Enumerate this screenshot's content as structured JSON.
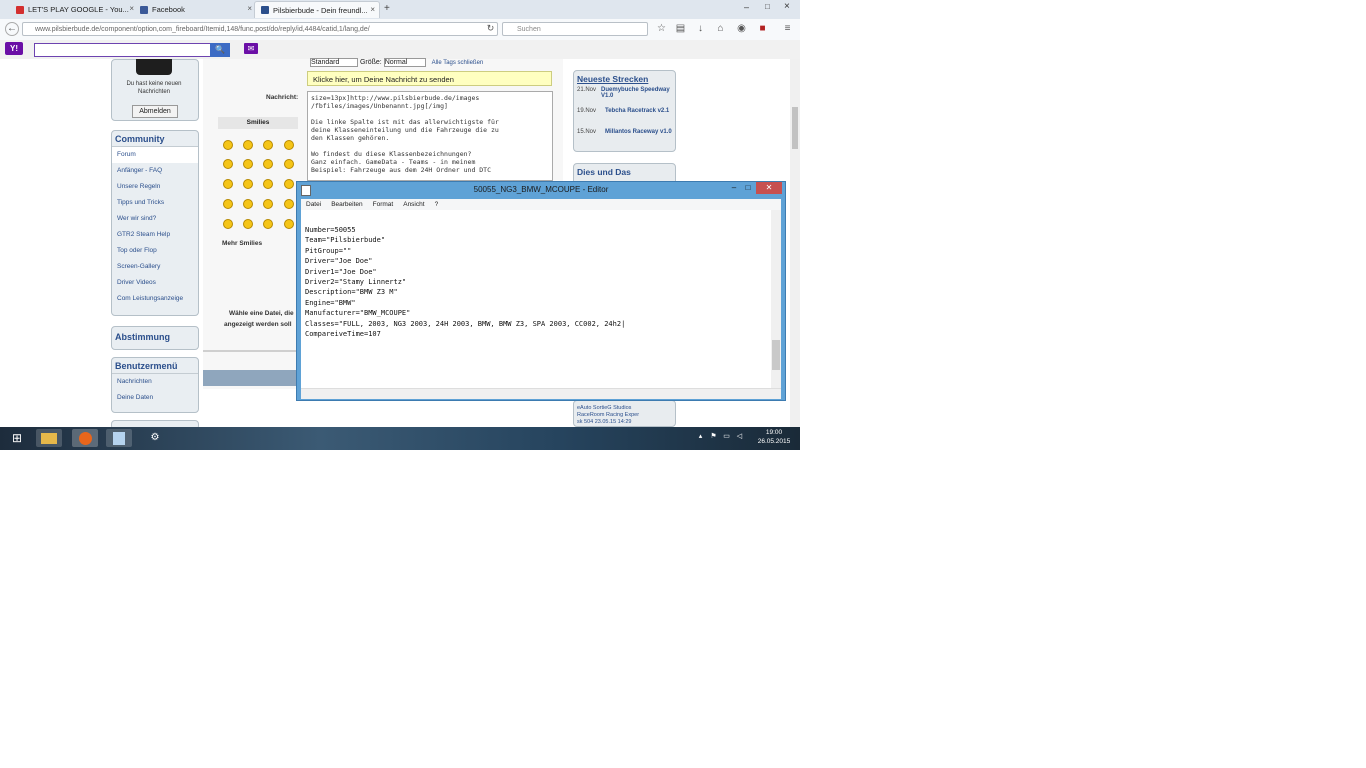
{
  "browser": {
    "tabs": [
      {
        "label": "LET'S PLAY GOOGLE - You...",
        "color": "#d32f2f"
      },
      {
        "label": "Facebook",
        "color": "#3b5998"
      },
      {
        "label": "Pilsbierbude - Dein freundl...",
        "color": "#2b4f8c"
      }
    ],
    "new_tab": "+",
    "url": "www.pilsbierbude.de/component/option,com_fireboard/Itemid,148/func,post/do/reply/id,4484/catid,1/lang,de/",
    "search_placeholder": "Suchen",
    "window_controls": {
      "minimize": "–",
      "maximize": "□",
      "close": "×"
    }
  },
  "yahoo": {
    "logo": "Y!",
    "search_button": "🔍",
    "mail": "✉"
  },
  "left_sidebar": {
    "notice": "Du hast keine neuen Nachrichten",
    "logout": "Abmelden",
    "community": {
      "title": "Community",
      "items": [
        "Forum",
        "Anfänger - FAQ",
        "Unsere Regeln",
        "Tipps und Tricks",
        "Wer wir sind?",
        "GTR2 Steam Help",
        "Top oder Flop",
        "Screen-Gallery",
        "Driver Videos",
        "Com Leistungsanzeige"
      ]
    },
    "voting": {
      "title": "Abstimmung"
    },
    "usermenu": {
      "title": "Benutzermenü",
      "items": [
        "Nachrichten",
        "Deine Daten"
      ]
    }
  },
  "post_form": {
    "format_row": {
      "font": "Standard",
      "size_label": "Größe:",
      "size": "Normal",
      "close_tags": "Alle Tags schließen"
    },
    "yellow_notice": "Klicke hier, um Deine Nachricht zu senden",
    "message_label": "Nachricht:",
    "smilies_title": "Smilies",
    "more_smilies": "Mehr Smilies",
    "message_text": "size=13px]http://www.pilsbierbude.de/images\n/fbfiles/images/Unbenannt.jpg[/img]\n\nDie linke Spalte ist mit das allerwichtigste für\ndeine Klasseneinteilung und die Fahrzeuge die zu\nden Klassen gehören.\n\nWo findest du diese Klassenbezeichnungen?\nGanz einfach. GameData - Teams - in meinem\nBeispiel: Fahrzeuge aus dem 24H Ordner und DTC",
    "file_label": "Wähle eine Datei, die",
    "file_label2": "angezeigt werden soll"
  },
  "right_sidebar": {
    "tracks": {
      "title": "Neueste Strecken",
      "items": [
        {
          "date": "21.Nov",
          "name": "Duemybuche Speedway V1.0"
        },
        {
          "date": "19.Nov",
          "name": "Tebcha Racetrack v2.1"
        },
        {
          "date": "15.Nov",
          "name": "Millantos Raceway v1.0"
        }
      ]
    },
    "misc": {
      "title": "Dies und Das"
    },
    "bottom": {
      "line1": "eAuto SortieG Studios",
      "line2": "RaceRoom Racing Exper",
      "line3": "sk 504 23.05.15 14:29"
    }
  },
  "notepad": {
    "title": "50055_NG3_BMW_MCOUPE - Editor",
    "menu": [
      "Datei",
      "Bearbeiten",
      "Format",
      "Ansicht",
      "?"
    ],
    "content": "Number=50055\nTeam=\"Pilsbierbude\"\nPitGroup=\"\"\nDriver=\"Joe Doe\"\nDriver1=\"Joe Doe\"\nDriver2=\"Stamy Linnertz\"\nDescription=\"BMW Z3 M\"\nEngine=\"BMW\"\nManufacturer=\"BMW_MCOUPE\"\nClasses=\"FULL, 2003, NG3 2003, 24H 2003, BMW, BMW Z3, SPA 2003, CC002, 24h2|\nCompareiveTime=107"
  },
  "taskbar": {
    "clock_time": "19:00",
    "clock_date": "26.05.2015"
  }
}
